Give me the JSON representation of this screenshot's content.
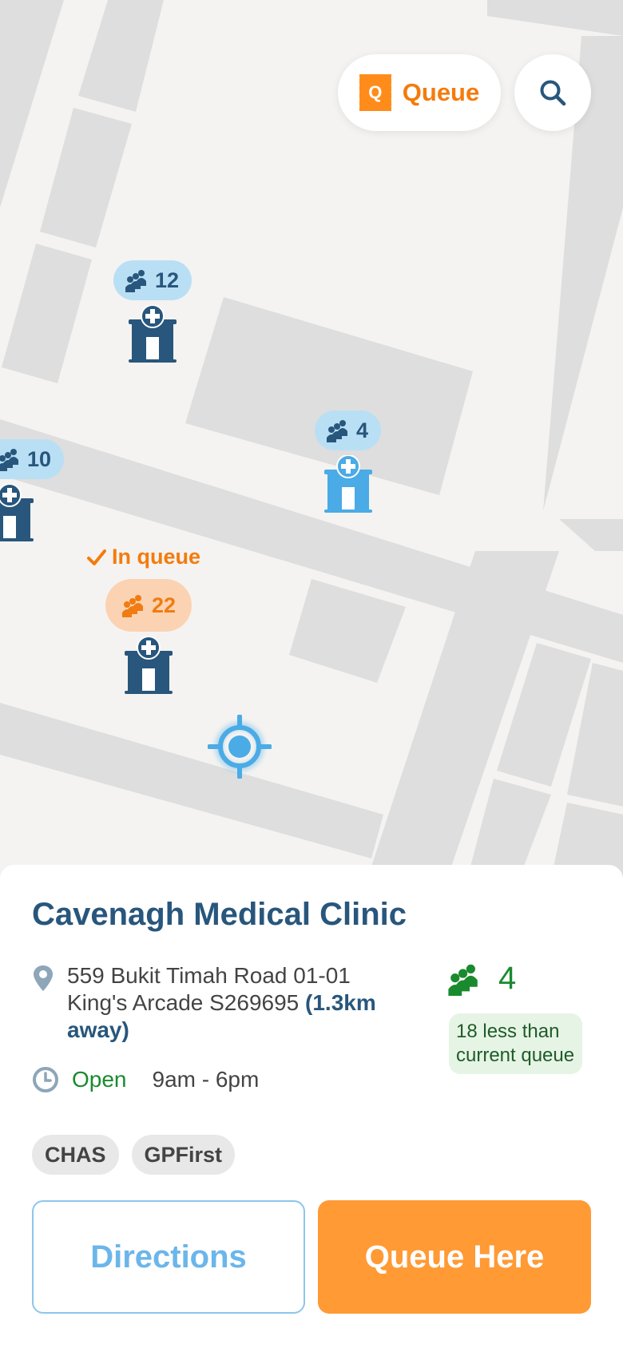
{
  "header": {
    "queue_button_label": "Queue",
    "ticket_letter": "Q",
    "search_icon": "search-icon"
  },
  "map": {
    "pins": [
      {
        "count": "12",
        "color": "#28567c"
      },
      {
        "count": "4",
        "color": "#4aabe6"
      },
      {
        "count": "10",
        "color": "#28567c"
      },
      {
        "count": "22",
        "color": "#28567c"
      }
    ],
    "in_queue_label": "In queue"
  },
  "clinic": {
    "name": "Cavenagh Medical Clinic",
    "address": "559 Bukit Timah Road 01-01 King's Arcade S269695",
    "distance": "(1.3km away)",
    "status": "Open",
    "hours": "9am - 6pm",
    "queue_count": "4",
    "queue_note_line1": "18 less than",
    "queue_note_line2": "current queue",
    "tags": [
      "CHAS",
      "GPFirst"
    ]
  },
  "actions": {
    "directions_label": "Directions",
    "queue_here_label": "Queue Here"
  },
  "colors": {
    "accent_orange": "#ff9a35",
    "brand_blue": "#28567c",
    "light_blue": "#6bb6ea",
    "green": "#1a8a2e"
  }
}
